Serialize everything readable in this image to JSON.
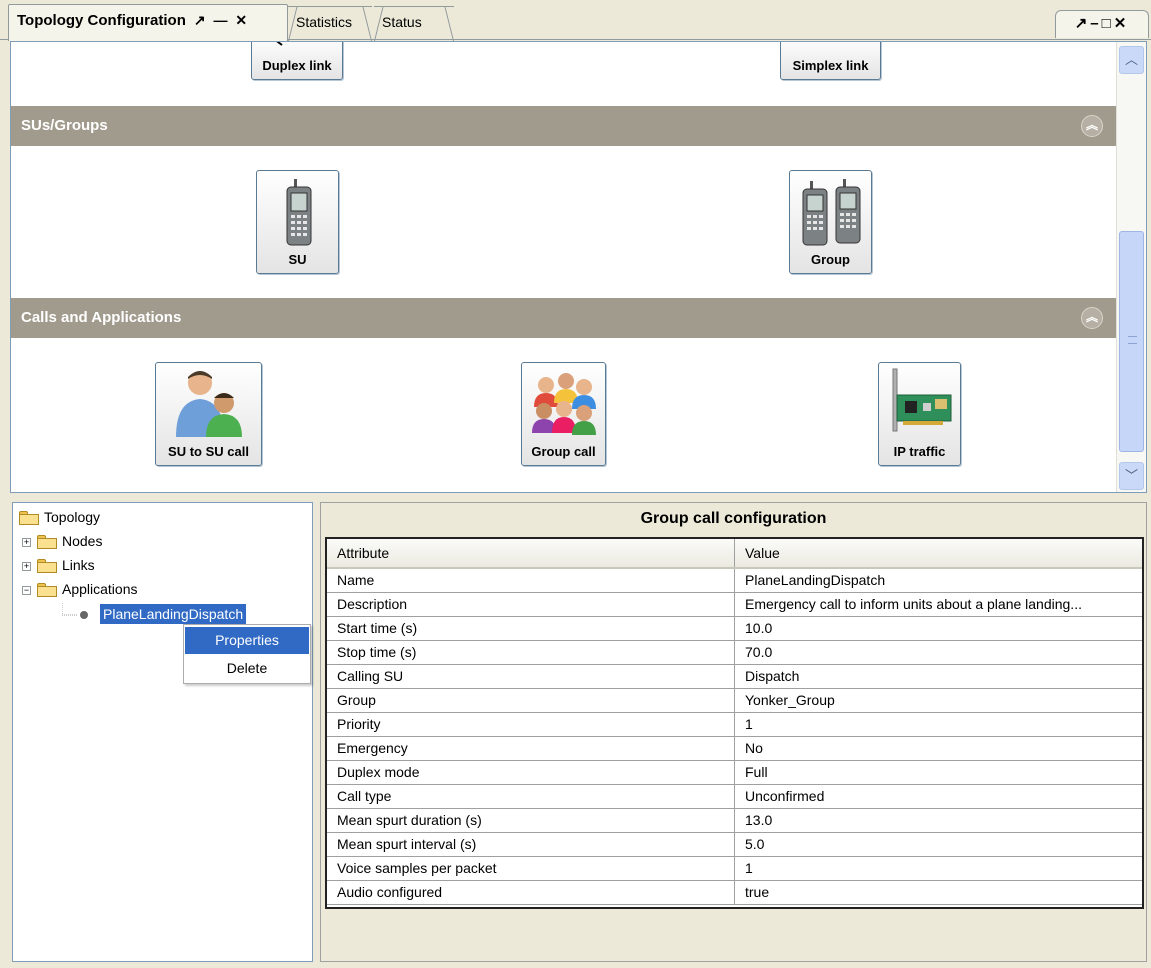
{
  "tabs": {
    "active": "Topology Configuration",
    "active_controls": "↗ — ✕",
    "statistics": "Statistics",
    "status": "Status",
    "window_controls": "↗–□✕"
  },
  "palette": {
    "links": {
      "duplex": "Duplex link",
      "simplex": "Simplex link"
    },
    "sus_groups": {
      "header": "SUs/Groups",
      "su": "SU",
      "group": "Group"
    },
    "calls": {
      "header": "Calls and Applications",
      "su_to_su": "SU to SU call",
      "group_call": "Group call",
      "ip_traffic": "IP traffic"
    }
  },
  "tree": {
    "root": "Topology",
    "nodes": "Nodes",
    "links": "Links",
    "applications": "Applications",
    "selected_app": "PlaneLandingDispatch"
  },
  "context_menu": {
    "properties": "Properties",
    "delete": "Delete"
  },
  "config": {
    "title": "Group call configuration",
    "header": {
      "attribute": "Attribute",
      "value": "Value"
    },
    "rows": [
      {
        "attribute": "Name",
        "value": "PlaneLandingDispatch"
      },
      {
        "attribute": "Description",
        "value": "Emergency call to inform units about a plane landing..."
      },
      {
        "attribute": "Start time (s)",
        "value": "10.0"
      },
      {
        "attribute": "Stop time (s)",
        "value": "70.0"
      },
      {
        "attribute": "Calling SU",
        "value": "Dispatch"
      },
      {
        "attribute": "Group",
        "value": "Yonker_Group"
      },
      {
        "attribute": "Priority",
        "value": "1"
      },
      {
        "attribute": "Emergency",
        "value": "No"
      },
      {
        "attribute": "Duplex mode",
        "value": "Full"
      },
      {
        "attribute": "Call type",
        "value": "Unconfirmed"
      },
      {
        "attribute": "Mean spurt duration (s)",
        "value": "13.0"
      },
      {
        "attribute": "Mean spurt interval (s)",
        "value": "5.0"
      },
      {
        "attribute": "Voice samples per packet",
        "value": "1"
      },
      {
        "attribute": "Audio configured",
        "value": "true"
      }
    ]
  },
  "colors": {
    "section_header": "#a19b8d",
    "selection": "#316ac5",
    "scrollbar": "#c6d6f8"
  },
  "icons": {
    "section_collapse": "double-chevron-up-icon",
    "scroll_up": "chevron-up-icon",
    "scroll_down": "chevron-down-icon"
  }
}
